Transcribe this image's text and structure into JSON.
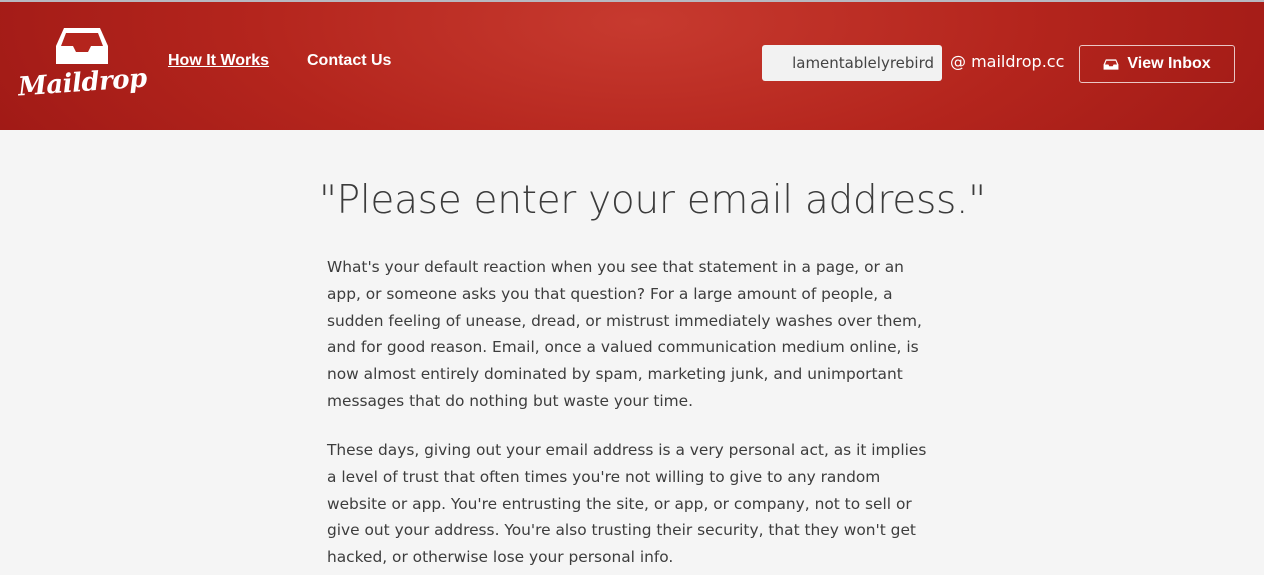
{
  "brand": {
    "name": "Maildrop"
  },
  "nav": {
    "how_it_works": "How It Works",
    "contact_us": "Contact Us"
  },
  "inbox_form": {
    "mailbox_value": "lamentablelyrebird",
    "domain_suffix": "@ maildrop.cc",
    "view_button_label": "View Inbox"
  },
  "main": {
    "headline": "\"Please enter your email address.\"",
    "paragraphs": [
      "What's your default reaction when you see that statement in a page, or an app, or someone asks you that question? For a large amount of people, a sudden feeling of unease, dread, or mistrust immediately washes over them, and for good reason. Email, once a valued communication medium online, is now almost entirely dominated by spam, marketing junk, and unimportant messages that do nothing but waste your time.",
      "These days, giving out your email address is a very personal act, as it implies a level of trust that often times you're not willing to give to any random website or app. You're entrusting the site, or app, or company, not to sell or give out your address. You're also trusting their security, that they won't get hacked, or otherwise lose your personal info."
    ]
  },
  "icons": {
    "logo": "inbox-tray-icon",
    "button": "inbox-tray-icon"
  },
  "colors": {
    "header_red": "#b4251d",
    "page_background": "#f5f5f5",
    "text": "#3d3d3d"
  }
}
